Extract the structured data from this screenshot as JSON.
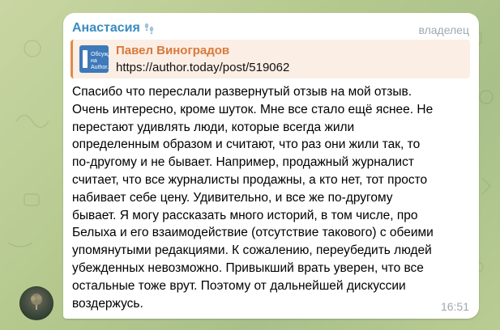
{
  "message": {
    "sender": "Анастасия",
    "role": "владелец",
    "reply": {
      "name": "Павел Виноградов",
      "text": "https://author.today/post/519062",
      "thumb_label": "Обсужд на Author.T"
    },
    "text": "Спасибо что переслали развернутый отзыв на мой отзыв.\nОчень интересно, кроме шуток. Мне все стало ещё яснее. Не\nперестают удивлять люди, которые всегда жили\nопределенным образом и считают, что раз они жили так, то\nпо-другому и не бывает. Например, продажный журналист\nсчитает, что все журналисты продажны, а кто нет, тот просто\nнабивает себе цену. Удивительно, и все же по-другому\nбывает. Я могу рассказать много историй, в том числе, про\nБелыха и его взаимодействие (отсутствие такового) с обеими\nупомянутыми редакциями. К сожалению, переубедить людей\nубежденных невозможно. Привыкший врать уверен, что все\nостальные тоже врут. Поэтому от дальнейшей дискуссии\nвоздержусь.",
    "time": "16:51"
  },
  "colors": {
    "sender": "#3a8bc0",
    "reply_accent": "#e08a4a",
    "reply_bg": "#fbeee4",
    "muted": "#a0a8ae"
  },
  "icons": {
    "sender_icon": "footprints-icon",
    "avatar": "tree-avatar"
  }
}
